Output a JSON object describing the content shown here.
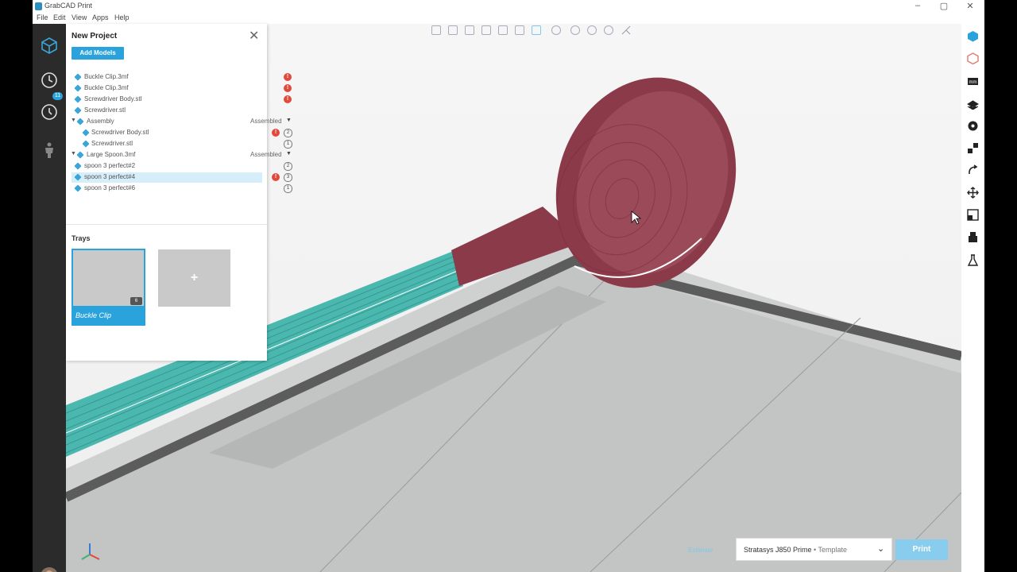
{
  "app": {
    "title": "GrabCAD Print"
  },
  "menu": [
    "File",
    "Edit",
    "View",
    "Apps",
    "Help"
  ],
  "nav": {
    "history_badge": "11"
  },
  "panel": {
    "title": "New Project",
    "add_models_label": "Add Models",
    "tree": [
      {
        "label": "Buckle Clip.3mf",
        "level": 0,
        "error": true
      },
      {
        "label": "Buckle Clip.3mf",
        "level": 0,
        "error": true
      },
      {
        "label": "Screwdriver Body.stl",
        "level": 0,
        "error": true
      },
      {
        "label": "Screwdriver.stl",
        "level": 0,
        "error": false
      },
      {
        "label": "Assembly",
        "level": 0,
        "group": true,
        "status": "Assembled"
      },
      {
        "label": "Screwdriver Body.stl",
        "level": 1,
        "error": true,
        "count": "2"
      },
      {
        "label": "Screwdriver.stl",
        "level": 1,
        "error": false,
        "count": "1"
      },
      {
        "label": "Large Spoon.3mf",
        "level": 0,
        "group": true,
        "status": "Assembled"
      },
      {
        "label": "spoon 3 perfect#2",
        "level": 1,
        "error": false,
        "count": "2"
      },
      {
        "label": "spoon 3 perfect#4",
        "level": 1,
        "error": true,
        "count": "3",
        "selected": true
      },
      {
        "label": "spoon 3 perfect#6",
        "level": 1,
        "error": false,
        "count": "1"
      }
    ],
    "trays_title": "Trays",
    "tray": {
      "name": "Buckle Clip",
      "count": "6"
    },
    "add_tray_label": "+"
  },
  "footer": {
    "estimate_label": "Estimate",
    "printer": "Stratasys J850 Prime",
    "printer_template": "• Template",
    "print_label": "Print"
  },
  "colors": {
    "accent": "#2aa3dc",
    "error": "#e04a3a",
    "spoon": "#8b3a4a",
    "handle": "#4bb8b0"
  }
}
